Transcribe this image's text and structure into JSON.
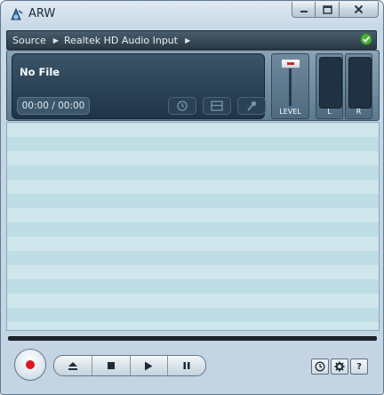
{
  "window": {
    "title": "ARW"
  },
  "source_bar": {
    "items": [
      {
        "label": "Source"
      },
      {
        "label": "Realtek HD Audio Input"
      }
    ]
  },
  "now_playing": {
    "file_name": "No File",
    "time": "00:00 / 00:00"
  },
  "meters": {
    "level_label": "LEVEL",
    "left_label": "L",
    "right_label": "R"
  },
  "help": {
    "label": "?"
  },
  "colors": {
    "record": "#e0141c",
    "list_row_a": "#cfe6ec",
    "list_row_b": "#bedde5",
    "panel_dark": "#1f3446"
  }
}
